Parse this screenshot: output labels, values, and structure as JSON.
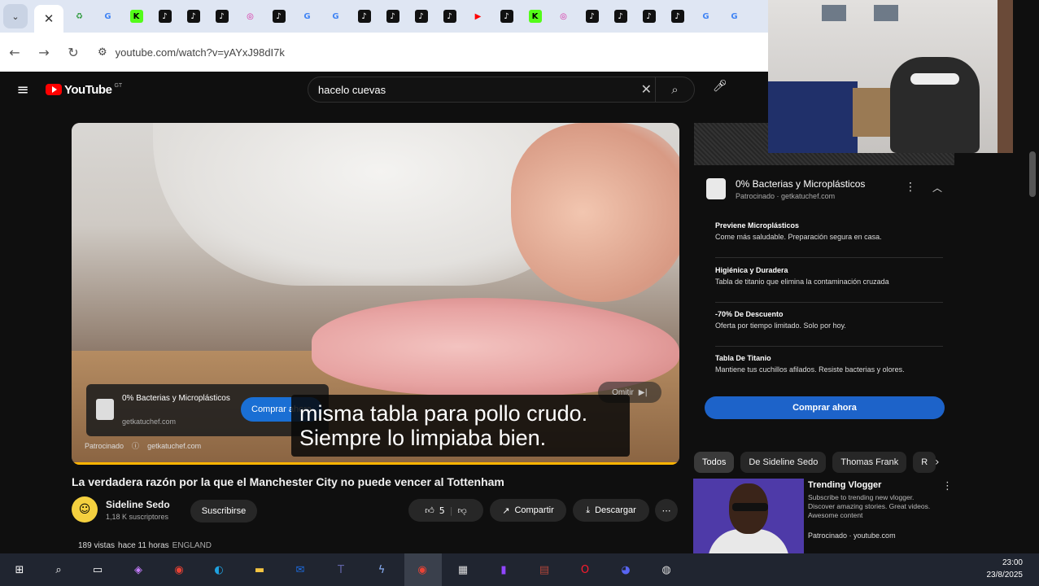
{
  "browser": {
    "url": "youtube.com/watch?v=yAYxJ98dI7k",
    "tabs": [
      {
        "icon": "recycle-icon",
        "glyph": "♻",
        "color": "#2e9a3c"
      },
      {
        "icon": "google-icon",
        "glyph": "G",
        "color": "#4285f4"
      },
      {
        "icon": "kick-icon",
        "glyph": "K",
        "color": "#53fc18"
      },
      {
        "icon": "tiktok-icon",
        "glyph": "♪",
        "color": "#111111"
      },
      {
        "icon": "tiktok-icon",
        "glyph": "♪",
        "color": "#111111"
      },
      {
        "icon": "tiktok-icon",
        "glyph": "♪",
        "color": "#111111"
      },
      {
        "icon": "instagram-icon",
        "glyph": "◎",
        "color": "#d6249f"
      },
      {
        "icon": "tiktok-icon",
        "glyph": "♪",
        "color": "#111111"
      },
      {
        "icon": "google-icon",
        "glyph": "G",
        "color": "#4285f4"
      },
      {
        "icon": "google-icon",
        "glyph": "G",
        "color": "#4285f4"
      },
      {
        "icon": "tiktok-icon",
        "glyph": "♪",
        "color": "#111111"
      },
      {
        "icon": "tiktok-icon",
        "glyph": "♪",
        "color": "#111111"
      },
      {
        "icon": "tiktok-icon",
        "glyph": "♪",
        "color": "#111111"
      },
      {
        "icon": "tiktok-icon",
        "glyph": "♪",
        "color": "#111111"
      },
      {
        "icon": "youtube-icon",
        "glyph": "▶",
        "color": "#ff0000"
      },
      {
        "icon": "tiktok-icon",
        "glyph": "♪",
        "color": "#111111"
      },
      {
        "icon": "kick-icon",
        "glyph": "K",
        "color": "#53fc18"
      },
      {
        "icon": "instagram-icon",
        "glyph": "◎",
        "color": "#d6249f"
      },
      {
        "icon": "tiktok-icon",
        "glyph": "♪",
        "color": "#111111"
      },
      {
        "icon": "tiktok-icon",
        "glyph": "♪",
        "color": "#111111"
      },
      {
        "icon": "tiktok-icon",
        "glyph": "♪",
        "color": "#111111"
      },
      {
        "icon": "tiktok-icon",
        "glyph": "♪",
        "color": "#111111"
      },
      {
        "icon": "google-icon",
        "glyph": "G",
        "color": "#4285f4"
      },
      {
        "icon": "google-icon",
        "glyph": "G",
        "color": "#4285f4"
      }
    ]
  },
  "youtube": {
    "logo_text": "YouTube",
    "logo_country": "GT",
    "search_query": "hacelo cuevas"
  },
  "player": {
    "subtitle": "misma tabla para pollo crudo. Siempre lo limpiaba bien.",
    "ad_title": "0% Bacterias y Microplásticos",
    "ad_domain": "getkatuchef.com",
    "ad_cta": "Comprar ahora",
    "sponsor_label": "Patrocinado",
    "sponsor_domain": "getkatuchef.com",
    "skip_label": "Omitir"
  },
  "video": {
    "title": "La verdadera razón por la que el Manchester City no puede vencer al Tottenham",
    "channel": "Sideline Sedo",
    "subscribers": "1,18 K suscriptores",
    "subscribe_label": "Suscribirse",
    "likes": "5",
    "share_label": "Compartir",
    "download_label": "Descargar",
    "meta_views": "189 vistas",
    "meta_time": "hace 11 horas",
    "meta_location": "ENGLAND"
  },
  "sidebar_ad": {
    "title": "0% Bacterias y Microplásticos",
    "sponsored": "Patrocinado · getkatuchef.com",
    "features": [
      {
        "title": "Previene Microplásticos",
        "desc": "Come más saludable. Preparación segura en casa."
      },
      {
        "title": "Higiénica y Duradera",
        "desc": "Tabla de titanio que elimina la contaminación cruzada"
      },
      {
        "title": "-70% De Descuento",
        "desc": "Oferta por tiempo limitado. Solo por hoy."
      },
      {
        "title": "Tabla De Titanio",
        "desc": "Mantiene tus cuchillos afilados. Resiste bacterias y olores."
      }
    ],
    "cta": "Comprar ahora"
  },
  "chips": [
    "Todos",
    "De Sideline Sedo",
    "Thomas Frank",
    "R"
  ],
  "recommended": {
    "title": "Trending Vlogger",
    "desc": "Subscribe to trending new vlogger. Discover amazing stories. Great videos. Awesome content",
    "sponsor": "Patrocinado · youtube.com"
  },
  "taskbar": {
    "time": "23:00",
    "date": "23/8/2025",
    "apps": [
      {
        "icon": "windows-start-icon",
        "glyph": "⊞",
        "color": "#ffffff"
      },
      {
        "icon": "search-icon",
        "glyph": "⌕",
        "color": "#ffffff"
      },
      {
        "icon": "task-view-icon",
        "glyph": "▭",
        "color": "#ffffff"
      },
      {
        "icon": "copilot-icon",
        "glyph": "◈",
        "color": "#c77dff"
      },
      {
        "icon": "chrome-icon",
        "glyph": "◉",
        "color": "#ea4335"
      },
      {
        "icon": "edge-icon",
        "glyph": "◐",
        "color": "#1fa2e0"
      },
      {
        "icon": "file-explorer-icon",
        "glyph": "▬",
        "color": "#f5c542"
      },
      {
        "icon": "outlook-icon",
        "glyph": "✉",
        "color": "#1d6ce0"
      },
      {
        "icon": "teams-icon",
        "glyph": "T",
        "color": "#6264a7"
      },
      {
        "icon": "lightning-app-icon",
        "glyph": "ϟ",
        "color": "#8fb6ff"
      },
      {
        "icon": "chrome-active-icon",
        "glyph": "◉",
        "color": "#ea4335"
      },
      {
        "icon": "calendar-app-icon",
        "glyph": "▦",
        "color": "#dddddd"
      },
      {
        "icon": "twitch-icon",
        "glyph": "▮",
        "color": "#9146ff"
      },
      {
        "icon": "winrar-icon",
        "glyph": "▤",
        "color": "#b0453a"
      },
      {
        "icon": "opera-icon",
        "glyph": "O",
        "color": "#ff1b2d"
      },
      {
        "icon": "discord-icon",
        "glyph": "◕",
        "color": "#5865f2"
      },
      {
        "icon": "obs-icon",
        "glyph": "◍",
        "color": "#dddddd"
      }
    ]
  }
}
